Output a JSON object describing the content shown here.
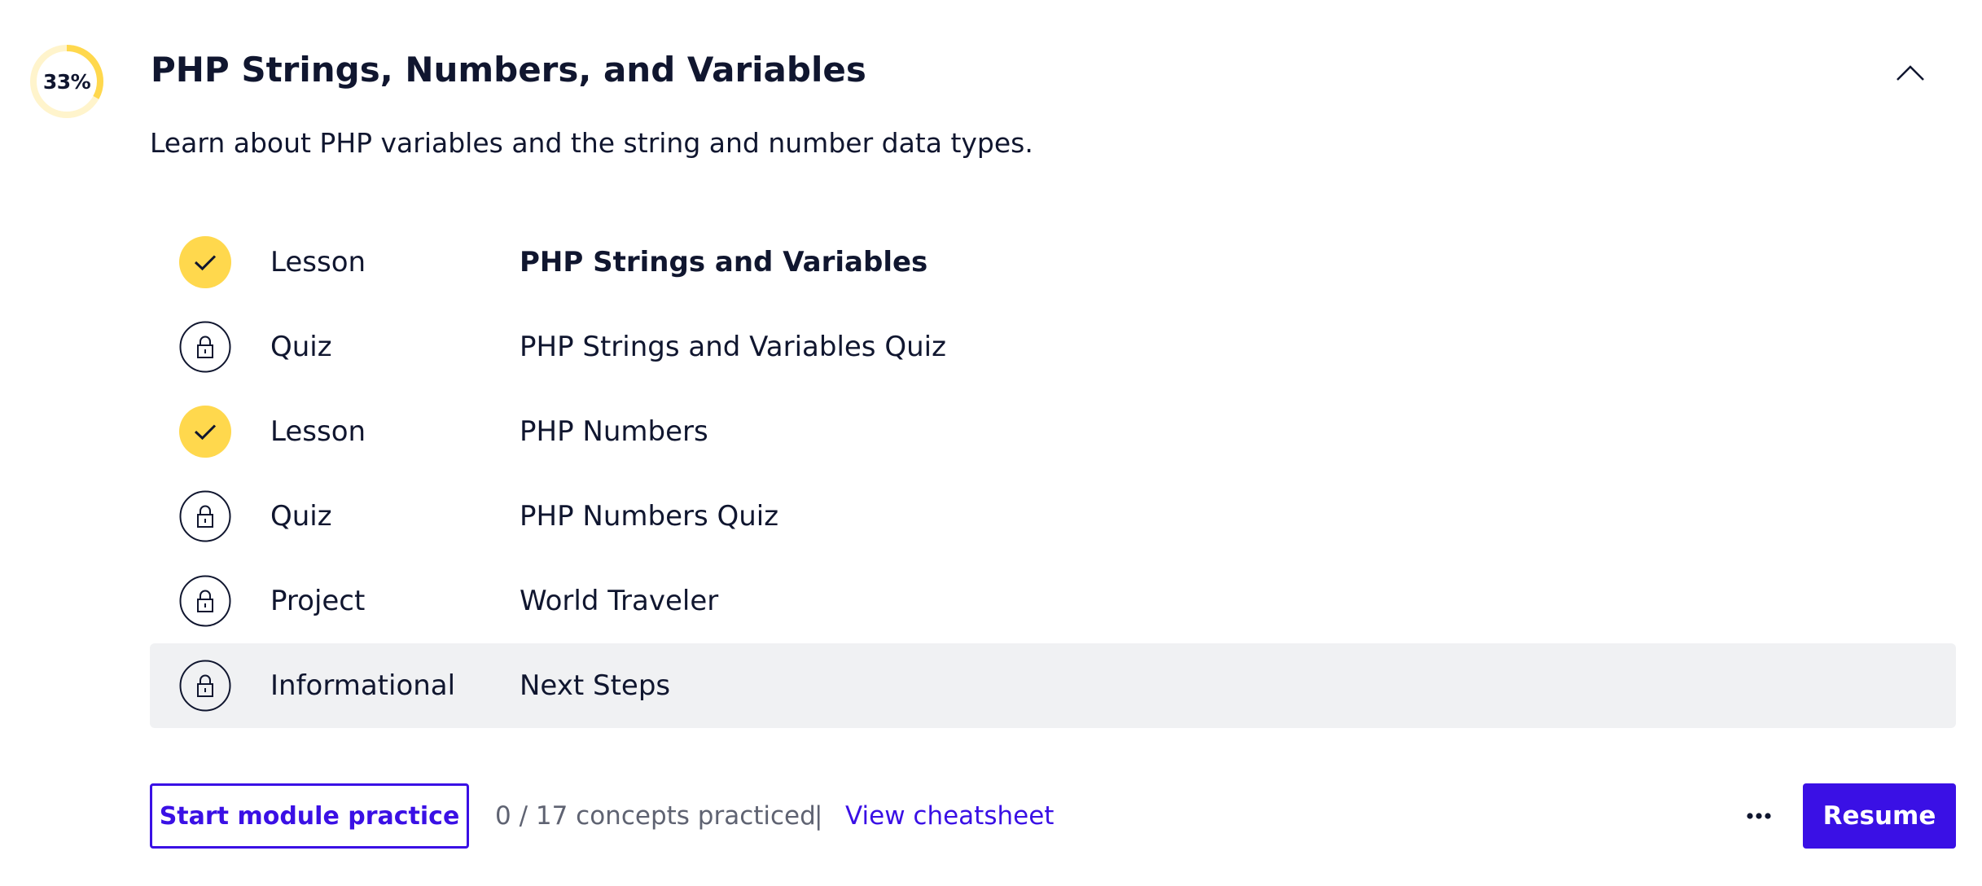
{
  "module": {
    "progress_label": "33%",
    "progress_fraction": 0.33,
    "title": "PHP Strings, Numbers, and Variables",
    "description": "Learn about PHP variables and the string and number data types.",
    "collapse_icon": "chevron-up-icon"
  },
  "items": [
    {
      "type": "Lesson",
      "name": "PHP Strings and Variables",
      "status": "completed",
      "icon": "check-icon",
      "bold": true,
      "highlighted": false
    },
    {
      "type": "Quiz",
      "name": "PHP Strings and Variables Quiz",
      "status": "locked",
      "icon": "lock-icon",
      "bold": false,
      "highlighted": false
    },
    {
      "type": "Lesson",
      "name": "PHP Numbers",
      "status": "completed",
      "icon": "check-icon",
      "bold": false,
      "highlighted": false
    },
    {
      "type": "Quiz",
      "name": "PHP Numbers Quiz",
      "status": "locked",
      "icon": "lock-icon",
      "bold": false,
      "highlighted": false
    },
    {
      "type": "Project",
      "name": "World Traveler",
      "status": "locked",
      "icon": "lock-icon",
      "bold": false,
      "highlighted": false
    },
    {
      "type": "Informational",
      "name": "Next Steps",
      "status": "locked",
      "icon": "lock-icon",
      "bold": false,
      "highlighted": true
    }
  ],
  "footer": {
    "practice_label": "Start module practice",
    "concepts_text": "0 / 17 concepts practiced",
    "divider": "|",
    "cheatsheet_label": "View cheatsheet",
    "more_icon": "more-dots-icon",
    "resume_label": "Resume"
  },
  "colors": {
    "accent": "#3a10e5",
    "completed": "#ffd84d",
    "progress_track": "#fff4cc",
    "text": "#10162f",
    "muted_text": "#5f6372",
    "row_highlight": "#f0f1f3"
  }
}
